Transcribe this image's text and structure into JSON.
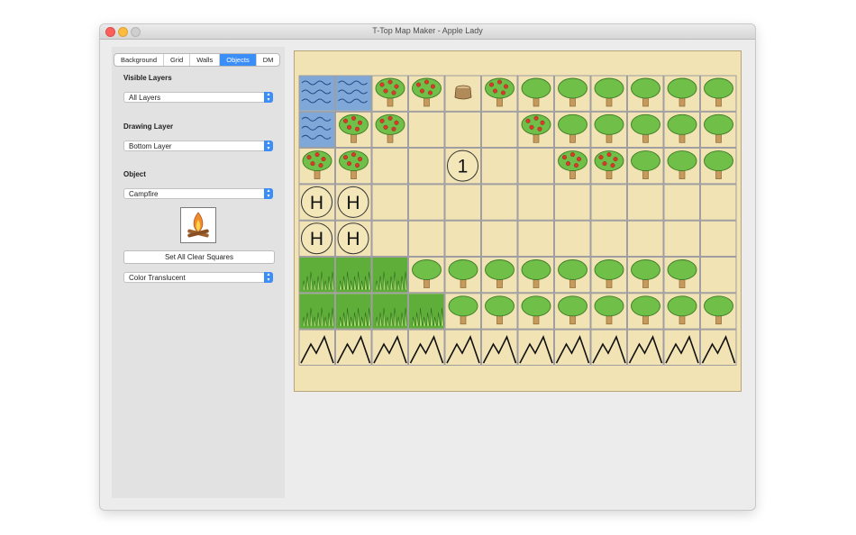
{
  "window": {
    "title": "T-Top Map Maker - Apple Lady"
  },
  "tabs": [
    {
      "label": "Background",
      "active": false
    },
    {
      "label": "Grid",
      "active": false
    },
    {
      "label": "Walls",
      "active": false
    },
    {
      "label": "Objects",
      "active": true
    },
    {
      "label": "DM",
      "active": false
    }
  ],
  "visible_layers": {
    "label": "Visible Layers",
    "value": "All Layers"
  },
  "drawing_layer": {
    "label": "Drawing Layer",
    "value": "Bottom Layer"
  },
  "object": {
    "label": "Object",
    "value": "Campfire",
    "preview_icon": "campfire-icon"
  },
  "set_clear_button": {
    "label": "Set All Clear Squares"
  },
  "color_mode": {
    "value": "Color Translucent"
  },
  "map": {
    "rows": [
      [
        "water",
        "water",
        "apple-tree",
        "apple-tree",
        "stump",
        "apple-tree",
        "tree",
        "tree",
        "tree",
        "tree",
        "tree",
        "tree"
      ],
      [
        "water",
        "apple-tree",
        "apple-tree",
        "",
        "",
        "",
        "apple-tree",
        "tree",
        "tree",
        "tree",
        "tree",
        "tree"
      ],
      [
        "apple-tree",
        "apple-tree",
        "",
        "",
        "token:1",
        "",
        "",
        "apple-tree",
        "apple-tree",
        "tree",
        "tree",
        "tree"
      ],
      [
        "token:H",
        "token:H",
        "",
        "",
        "",
        "",
        "",
        "",
        "",
        "",
        "",
        ""
      ],
      [
        "token:H",
        "token:H",
        "",
        "",
        "",
        "",
        "",
        "",
        "",
        "",
        "",
        ""
      ],
      [
        "grass",
        "grass",
        "grass",
        "tree",
        "tree",
        "tree",
        "tree",
        "tree",
        "tree",
        "tree",
        "tree",
        ""
      ],
      [
        "grass",
        "grass",
        "grass",
        "grass",
        "tree",
        "tree",
        "tree",
        "tree",
        "tree",
        "tree",
        "tree",
        "tree"
      ],
      [
        "mountain",
        "mountain",
        "mountain",
        "mountain",
        "mountain",
        "mountain",
        "mountain",
        "mountain",
        "mountain",
        "mountain",
        "mountain",
        "mountain"
      ]
    ]
  },
  "colors": {
    "accent": "#3b8df7",
    "parchment": "#f1e3b3",
    "water": "#7fa8d8",
    "grass": "#5fae3a",
    "tree_canopy": "#6fbf48",
    "trunk": "#c79a5b",
    "apple": "#d93a2b"
  }
}
